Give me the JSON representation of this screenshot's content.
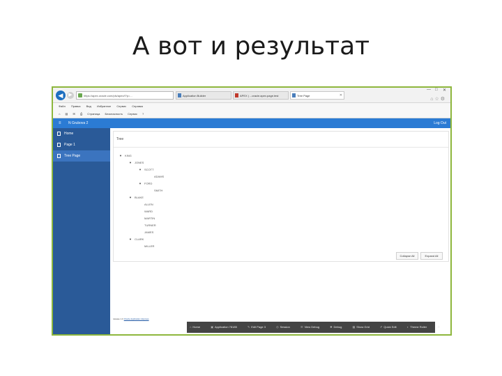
{
  "slide_title": "А вот и результат",
  "browser": {
    "address": "https://apex.oracle.com/pls/apex/f?p=...",
    "tabs": [
      {
        "label": "Application Builder"
      },
      {
        "label": "APEX | ...oracle.apex.page.test"
      },
      {
        "label": "Tree Page"
      }
    ],
    "window_controls": {
      "minimize": "—",
      "restore": "□",
      "close": "✕"
    },
    "menu": [
      "Файл",
      "Правка",
      "Вид",
      "Избранное",
      "Сервис",
      "Справка"
    ],
    "favorites": [
      "Страница",
      "Безопасность",
      "Сервис"
    ]
  },
  "app": {
    "title": "N Grubova 2",
    "logout": "Log Out",
    "nav": [
      {
        "label": "Home"
      },
      {
        "label": "Page 1"
      },
      {
        "label": "Tree Page"
      }
    ]
  },
  "region": {
    "title": "Tree",
    "nodes": [
      {
        "label": "KING",
        "toggle": "▼"
      },
      {
        "label": "JONES",
        "toggle": "▼"
      },
      {
        "label": "SCOTT",
        "toggle": "▼"
      },
      {
        "label": "ADAMS",
        "toggle": ""
      },
      {
        "label": "FORD",
        "toggle": "▼"
      },
      {
        "label": "SMITH",
        "toggle": ""
      },
      {
        "label": "BLAKE",
        "toggle": "▼"
      },
      {
        "label": "ALLEN",
        "toggle": ""
      },
      {
        "label": "WARD",
        "toggle": ""
      },
      {
        "label": "MARTIN",
        "toggle": ""
      },
      {
        "label": "TURNER",
        "toggle": ""
      },
      {
        "label": "JAMES",
        "toggle": ""
      },
      {
        "label": "CLARK",
        "toggle": "▼"
      },
      {
        "label": "MILLER",
        "toggle": ""
      }
    ],
    "collapse_all": "Collapse All",
    "expand_all": "Expand All"
  },
  "footer": {
    "prefix": "release 1.0",
    "link": "Oracle Application Express"
  },
  "devbar": [
    "Home",
    "Application 78185",
    "Edit Page 3",
    "Session",
    "View Debug",
    "Debug",
    "Show Grid",
    "Quick Edit",
    "Theme Roller"
  ]
}
